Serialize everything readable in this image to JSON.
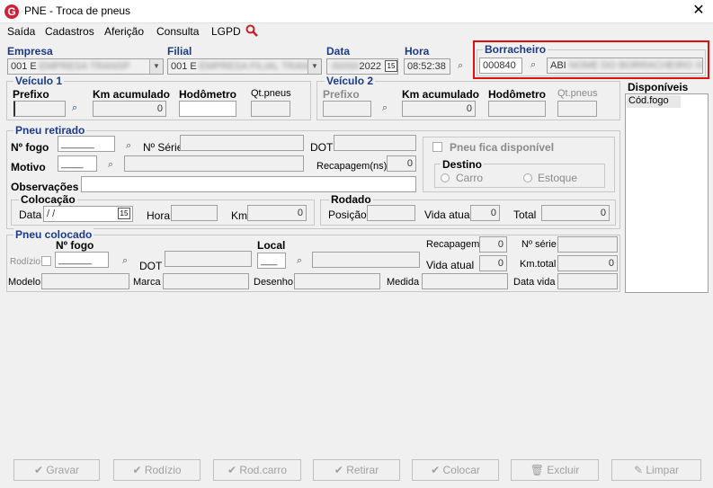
{
  "window": {
    "title": "PNE - Troca de pneus",
    "icon_letter": "G"
  },
  "menu": [
    "Saída",
    "Cadastros",
    "Aferição",
    "Consulta",
    "LGPD"
  ],
  "header": {
    "empresa_label": "Empresa",
    "empresa_value": "001 E",
    "filial_label": "Filial",
    "filial_value": "001 E",
    "data_label": "Data",
    "data_value": "2022",
    "hora_label": "Hora",
    "hora_value": "08:52:38",
    "borracheiro_label": "Borracheiro",
    "borracheiro_code": "000840",
    "borracheiro_name": "ABI"
  },
  "veiculo1": {
    "title": "Veículo 1",
    "prefixo": "Prefixo",
    "km": "Km acumulado",
    "km_value": "0",
    "hodometro": "Hodômetro",
    "qtpneus": "Qt.pneus"
  },
  "veiculo2": {
    "title": "Veículo 2",
    "prefixo": "Prefixo",
    "km": "Km acumulado",
    "km_value": "0",
    "hodometro": "Hodômetro",
    "qtpneus": "Qt.pneus"
  },
  "disponiveis": {
    "title": "Disponíveis",
    "header": "Cód.fogo"
  },
  "retirado": {
    "title": "Pneu retirado",
    "nfogo": "Nº fogo",
    "nserie": "Nº Série",
    "dot": "DOT",
    "motivo": "Motivo",
    "recapagem": "Recapagem(ns)",
    "recapagem_value": "0",
    "observacoes": "Observações",
    "fica_disponivel": "Pneu fica disponível",
    "destino": "Destino",
    "carro": "Carro",
    "estoque": "Estoque",
    "colocacao": "Colocação",
    "data": "Data",
    "data_value": " /  /",
    "hora": "Hora",
    "km": "Km",
    "km_value": "0",
    "rodado": "Rodado",
    "posicao": "Posição",
    "vida_atual": "Vida atual",
    "vida_value": "0",
    "total": "Total",
    "total_value": "0"
  },
  "colocado": {
    "title": "Pneu colocado",
    "nfogo": "Nº fogo",
    "local": "Local",
    "rodizio": "Rodízio",
    "dot": "DOT",
    "recapagem": "Recapagem",
    "recapagem_value": "0",
    "nserie": "Nº série",
    "vida_atual": "Vida atual",
    "vida_value": "0",
    "kmtotal": "Km.total",
    "kmtotal_value": "0",
    "modelo": "Modelo",
    "marca": "Marca",
    "desenho": "Desenho",
    "medida": "Medida",
    "data_vida": "Data vida"
  },
  "buttons": {
    "gravar": "Gravar",
    "rodizio": "Rodízio",
    "rodcarro": "Rod.carro",
    "retirar": "Retirar",
    "colocar": "Colocar",
    "excluir": "Excluir",
    "limpar": "Limpar"
  },
  "icons": [
    "search-icon",
    "binoculars-icon",
    "calendar-icon",
    "check-icon",
    "trash-icon",
    "broom-icon"
  ],
  "colors": {
    "highlight_border": "#e01010",
    "label_blue": "#1a3a8a",
    "app_icon": "#d0213a"
  }
}
